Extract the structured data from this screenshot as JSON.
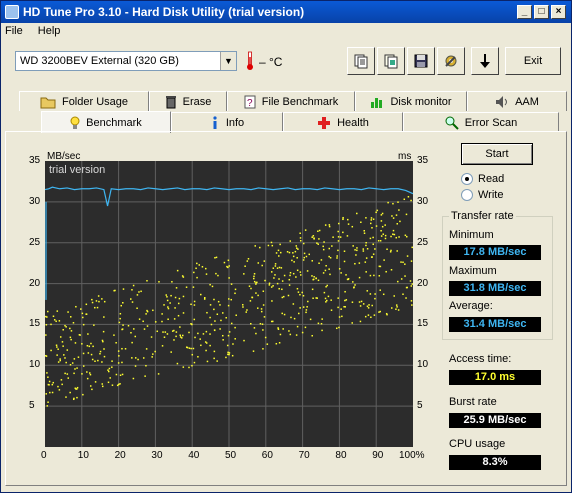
{
  "window": {
    "title": "HD Tune Pro 3.10 - Hard Disk Utility (trial version)"
  },
  "menu": {
    "file": "File",
    "help": "Help"
  },
  "drive": {
    "selected": "WD     3200BEV External (320 GB)",
    "temp": "– °C"
  },
  "toolbar": {
    "exit_label": "Exit"
  },
  "tabs_top": [
    "Folder Usage",
    "Erase",
    "File Benchmark",
    "Disk monitor",
    "AAM"
  ],
  "tabs_bottom": [
    "Benchmark",
    "Info",
    "Health",
    "Error Scan"
  ],
  "chart": {
    "y_left_unit": "MB/sec",
    "y_right_unit": "ms",
    "watermark": "trial version",
    "y_ticks": [
      "35",
      "30",
      "25",
      "20",
      "15",
      "10",
      "5"
    ],
    "x_ticks": [
      "0",
      "10",
      "20",
      "30",
      "40",
      "50",
      "60",
      "70",
      "80",
      "90",
      "100%"
    ]
  },
  "controls": {
    "start_label": "Start",
    "read_label": "Read",
    "write_label": "Write"
  },
  "transfer": {
    "title": "Transfer rate",
    "minimum_label": "Minimum",
    "minimum": "17.8 MB/sec",
    "maximum_label": "Maximum",
    "maximum": "31.8 MB/sec",
    "average_label": "Average:",
    "average": "31.4 MB/sec"
  },
  "access": {
    "label": "Access time:",
    "value": "17.0 ms"
  },
  "burst": {
    "label": "Burst rate",
    "value": "25.9 MB/sec"
  },
  "cpu": {
    "label": "CPU usage",
    "value": "8.3%"
  },
  "chart_data": {
    "type": "line",
    "xlabel": "",
    "ylabel": "MB/sec",
    "xlim": [
      0,
      100
    ],
    "ylim": [
      0,
      35
    ],
    "y2lim": [
      0,
      35
    ],
    "grid": true,
    "series": [
      {
        "values_x": [
          0,
          1,
          2,
          4,
          6,
          8,
          10,
          12,
          14,
          16,
          17,
          18,
          20,
          22,
          24,
          26,
          28,
          30,
          32,
          34,
          36,
          38,
          40,
          42,
          44,
          46,
          48,
          50,
          52,
          54,
          56,
          58,
          60,
          62,
          64,
          66,
          68,
          70,
          72,
          74,
          76,
          78,
          80,
          82,
          84,
          86,
          88,
          90,
          92,
          94,
          96,
          98,
          100
        ],
        "values_y": [
          31.5,
          31.6,
          31.8,
          31.6,
          31.7,
          31.5,
          31.6,
          31.6,
          31.7,
          31.5,
          29.5,
          31.6,
          31.5,
          31.6,
          31.6,
          31.5,
          31.7,
          31.6,
          31.5,
          31.6,
          31.7,
          31.5,
          31.6,
          31.6,
          31.5,
          31.7,
          31.6,
          31.5,
          31.6,
          31.6,
          31.5,
          31.7,
          31.6,
          31.5,
          31.6,
          31.7,
          31.5,
          31.6,
          31.6,
          31.5,
          31.7,
          31.6,
          31.5,
          31.6,
          31.6,
          31.5,
          31.7,
          31.6,
          31.5,
          31.6,
          31.6,
          31.4,
          31.0
        ]
      }
    ],
    "access_scatter_range": {
      "x": [
        0,
        100
      ],
      "y_low": [
        5,
        17
      ],
      "y_high": [
        17,
        31
      ]
    }
  },
  "colors": {
    "transfer_line": "#3fb6f2",
    "access_dots": "#ffff30",
    "grid": "#606060",
    "chart_bg": "#2c2c2c"
  }
}
